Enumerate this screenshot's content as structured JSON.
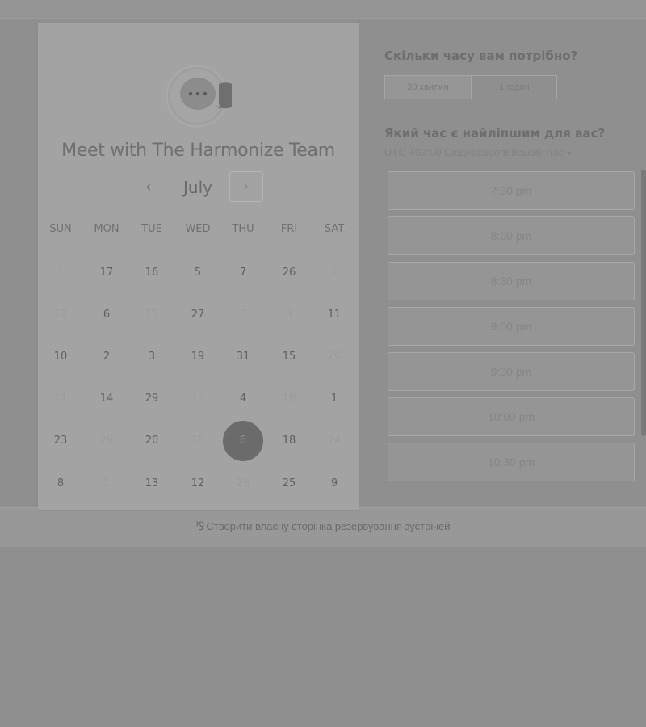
{
  "calendar": {
    "title": "Meet with The Harmonize Team",
    "month": "July",
    "prev_symbol": "‹",
    "next_symbol": "›",
    "weekdays": [
      "SUN",
      "MON",
      "TUE",
      "WED",
      "THU",
      "FRI",
      "SAT"
    ],
    "weeks": [
      [
        {
          "label": "1",
          "disabled": true
        },
        {
          "label": "17",
          "disabled": false
        },
        {
          "label": "16",
          "disabled": false
        },
        {
          "label": "5",
          "disabled": false
        },
        {
          "label": "7",
          "disabled": false
        },
        {
          "label": "26",
          "disabled": false
        },
        {
          "label": "2",
          "disabled": true
        }
      ],
      [
        {
          "label": "12",
          "disabled": true
        },
        {
          "label": "6",
          "disabled": false
        },
        {
          "label": "15",
          "disabled": true
        },
        {
          "label": "27",
          "disabled": false
        },
        {
          "label": "8",
          "disabled": true
        },
        {
          "label": "9",
          "disabled": true
        },
        {
          "label": "11",
          "disabled": false
        }
      ],
      [
        {
          "label": "10",
          "disabled": false
        },
        {
          "label": "2",
          "disabled": false
        },
        {
          "label": "3",
          "disabled": false
        },
        {
          "label": "19",
          "disabled": false
        },
        {
          "label": "31",
          "disabled": false
        },
        {
          "label": "15",
          "disabled": false
        },
        {
          "label": "26",
          "disabled": true
        }
      ],
      [
        {
          "label": "11",
          "disabled": true
        },
        {
          "label": "14",
          "disabled": false
        },
        {
          "label": "29",
          "disabled": false
        },
        {
          "label": "17",
          "disabled": true
        },
        {
          "label": "4",
          "disabled": false
        },
        {
          "label": "18",
          "disabled": true
        },
        {
          "label": "1",
          "disabled": false
        }
      ],
      [
        {
          "label": "23",
          "disabled": false
        },
        {
          "label": "29",
          "disabled": true
        },
        {
          "label": "20",
          "disabled": false
        },
        {
          "label": "18",
          "disabled": true
        },
        {
          "label": "6",
          "disabled": false,
          "selected": true
        },
        {
          "label": "18",
          "disabled": false
        },
        {
          "label": "24",
          "disabled": true
        }
      ],
      [
        {
          "label": "8",
          "disabled": false
        },
        {
          "label": "1",
          "disabled": true
        },
        {
          "label": "13",
          "disabled": false
        },
        {
          "label": "12",
          "disabled": false
        },
        {
          "label": "28",
          "disabled": true
        },
        {
          "label": "25",
          "disabled": false
        },
        {
          "label": "9",
          "disabled": false
        }
      ]
    ]
  },
  "scheduler": {
    "duration_question": "Скільки часу вам потрібно?",
    "durations": [
      "30 хвилин",
      "1 годин"
    ],
    "time_question": "Який час є найліпшим для вас?",
    "timezone": "UTC +03:00 Східноєвропейський час",
    "timezone_caret": "▾",
    "slots": [
      "7:30 pm",
      "8:00 pm",
      "8:30 pm",
      "9:00 pm",
      "9:30 pm",
      "10:00 pm",
      "10:30 pm"
    ]
  },
  "footer": {
    "icon": "⅋",
    "link_text": "Створити власну сторінка резервування зустрічей"
  },
  "colors": {
    "overlay_bg": "#8f8f8f",
    "card_bg": "#a3a3a3",
    "selected_day": "#6b6b6b"
  }
}
